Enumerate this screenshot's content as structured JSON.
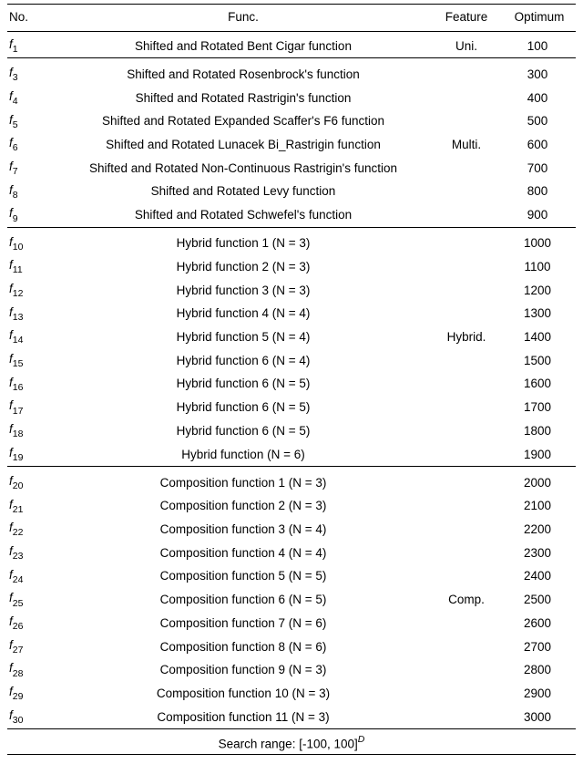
{
  "headers": {
    "no": "No.",
    "func": "Func.",
    "feature": "Feature",
    "optimum": "Optimum"
  },
  "groups": [
    {
      "feature": "Uni.",
      "rows": [
        {
          "idx": "1",
          "func": "Shifted and Rotated Bent Cigar function",
          "opt": "100"
        }
      ]
    },
    {
      "feature": "Multi.",
      "rows": [
        {
          "idx": "3",
          "func": "Shifted and Rotated Rosenbrock's function",
          "opt": "300"
        },
        {
          "idx": "4",
          "func": "Shifted and Rotated Rastrigin's function",
          "opt": "400"
        },
        {
          "idx": "5",
          "func": "Shifted and Rotated Expanded Scaffer's F6 function",
          "opt": "500"
        },
        {
          "idx": "6",
          "func": "Shifted and Rotated Lunacek Bi_Rastrigin function",
          "opt": "600"
        },
        {
          "idx": "7",
          "func": "Shifted and Rotated Non-Continuous Rastrigin's function",
          "opt": "700"
        },
        {
          "idx": "8",
          "func": "Shifted and Rotated Levy function",
          "opt": "800"
        },
        {
          "idx": "9",
          "func": "Shifted and Rotated Schwefel's function",
          "opt": "900"
        }
      ]
    },
    {
      "feature": "Hybrid.",
      "rows": [
        {
          "idx": "10",
          "func": "Hybrid function 1 (N = 3)",
          "opt": "1000"
        },
        {
          "idx": "11",
          "func": "Hybrid function 2 (N = 3)",
          "opt": "1100"
        },
        {
          "idx": "12",
          "func": "Hybrid function 3 (N = 3)",
          "opt": "1200"
        },
        {
          "idx": "13",
          "func": "Hybrid function 4 (N = 4)",
          "opt": "1300"
        },
        {
          "idx": "14",
          "func": "Hybrid function 5 (N = 4)",
          "opt": "1400"
        },
        {
          "idx": "15",
          "func": "Hybrid function 6 (N = 4)",
          "opt": "1500"
        },
        {
          "idx": "16",
          "func": "Hybrid function 6 (N = 5)",
          "opt": "1600"
        },
        {
          "idx": "17",
          "func": "Hybrid function 6 (N = 5)",
          "opt": "1700"
        },
        {
          "idx": "18",
          "func": "Hybrid function 6 (N = 5)",
          "opt": "1800"
        },
        {
          "idx": "19",
          "func": "Hybrid function (N = 6)",
          "opt": "1900"
        }
      ]
    },
    {
      "feature": "Comp.",
      "rows": [
        {
          "idx": "20",
          "func": "Composition function 1 (N = 3)",
          "opt": "2000"
        },
        {
          "idx": "21",
          "func": "Composition function 2 (N = 3)",
          "opt": "2100"
        },
        {
          "idx": "22",
          "func": "Composition function 3 (N = 4)",
          "opt": "2200"
        },
        {
          "idx": "23",
          "func": "Composition function 4 (N = 4)",
          "opt": "2300"
        },
        {
          "idx": "24",
          "func": "Composition function 5 (N = 5)",
          "opt": "2400"
        },
        {
          "idx": "25",
          "func": "Composition function 6 (N = 5)",
          "opt": "2500"
        },
        {
          "idx": "26",
          "func": "Composition function 7 (N = 6)",
          "opt": "2600"
        },
        {
          "idx": "27",
          "func": "Composition function 8 (N = 6)",
          "opt": "2700"
        },
        {
          "idx": "28",
          "func": "Composition function 9 (N = 3)",
          "opt": "2800"
        },
        {
          "idx": "29",
          "func": "Composition function 10 (N = 3)",
          "opt": "2900"
        },
        {
          "idx": "30",
          "func": "Composition function 11 (N = 3)",
          "opt": "3000"
        }
      ]
    }
  ],
  "footer": {
    "prefix": "Search range: [-100, 100]",
    "exp": "D"
  }
}
